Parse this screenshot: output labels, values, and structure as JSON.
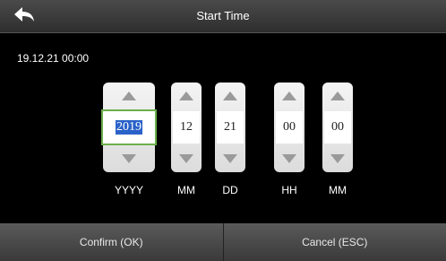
{
  "header": {
    "title": "Start Time",
    "back_icon": "back-arrow-icon"
  },
  "current_value": "19.12.21 00:00",
  "fields": [
    {
      "unit": "YYYY",
      "value": "2019",
      "selected": true
    },
    {
      "unit": "MM",
      "value": "12",
      "selected": false
    },
    {
      "unit": "DD",
      "value": "21",
      "selected": false
    },
    {
      "unit": "HH",
      "value": "00",
      "selected": false
    },
    {
      "unit": "MM",
      "value": "00",
      "selected": false
    }
  ],
  "footer": {
    "confirm_label": "Confirm (OK)",
    "cancel_label": "Cancel (ESC)"
  },
  "colors": {
    "selection_border": "#6ab04c",
    "selection_highlight": "#2a62c9",
    "arrow": "#9a9a9a"
  }
}
